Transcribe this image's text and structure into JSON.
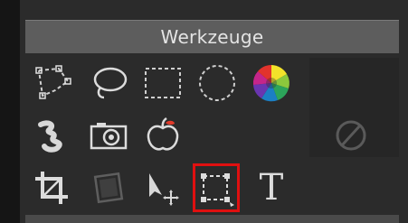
{
  "panel": {
    "title": "Werkzeuge"
  },
  "tools": {
    "row1": [
      "polygon-lasso-icon",
      "lasso-icon",
      "rect-marquee-icon",
      "ellipse-marquee-icon",
      "color-wheel-icon"
    ],
    "row2": [
      "smudge-icon",
      "camera-icon",
      "red-eye-apple-icon"
    ],
    "row3": [
      "crop-icon",
      "straighten-icon",
      "move-icon",
      "transform-selection-icon",
      "text-icon"
    ],
    "side": "disabled-icon",
    "text_tool_glyph": "T",
    "selected_tool": "transform-selection"
  },
  "colors": {
    "highlight": "#e01010",
    "header_bg": "#5d5d5d",
    "panel_bg": "#2b2b2b"
  }
}
